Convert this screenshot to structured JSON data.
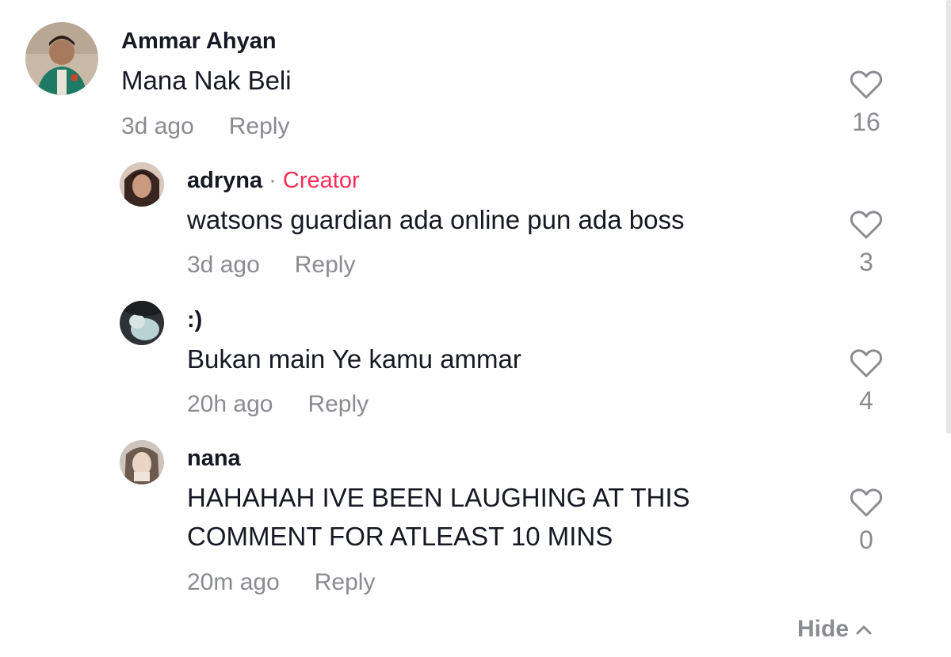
{
  "comments": [
    {
      "author": "Ammar Ahyan",
      "text": "Mana Nak Beli",
      "time": "3d ago",
      "reply": "Reply",
      "likes": "16"
    },
    {
      "author": "adryna",
      "dot": "·",
      "badge": "Creator",
      "text": "watsons guardian ada online pun ada boss",
      "time": "3d ago",
      "reply": "Reply",
      "likes": "3"
    },
    {
      "author": ":)",
      "text": "Bukan main Ye kamu ammar",
      "time": "20h ago",
      "reply": "Reply",
      "likes": "4"
    },
    {
      "author": "nana",
      "text_line1": "HAHAHAH IVE BEEN LAUGHING AT THIS",
      "text_line2": "COMMENT FOR ATLEAST 10 MINS",
      "time": "20m ago",
      "reply": "Reply",
      "likes": "0"
    }
  ],
  "hide_label": "Hide",
  "icons": {
    "like": "heart-outline-icon",
    "hide": "chevron-up-icon"
  },
  "colors": {
    "creator_badge": "#fe2c55",
    "muted": "#8a8b91",
    "text": "#161823"
  }
}
